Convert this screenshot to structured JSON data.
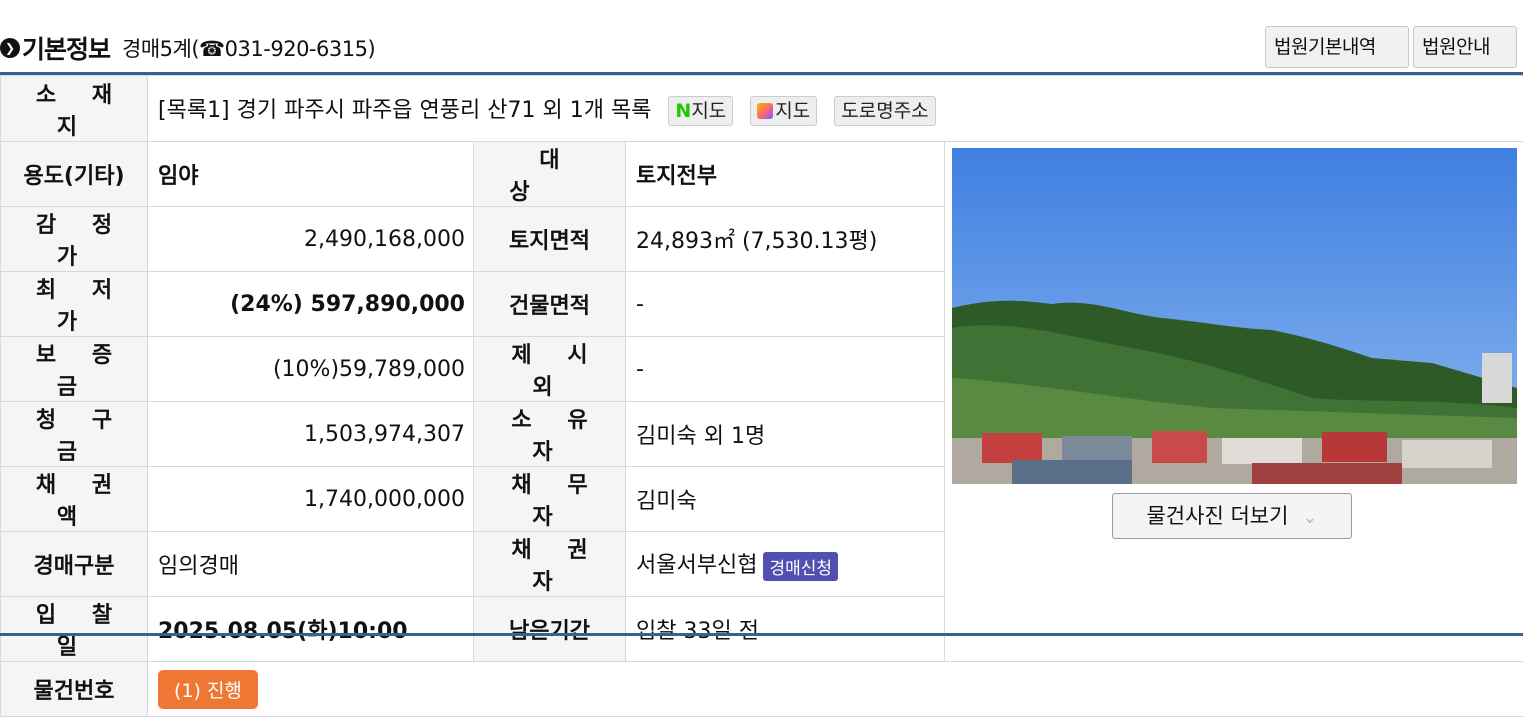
{
  "header": {
    "title": "기본정보",
    "department": "경매5계(☎031-920-6315)",
    "court_info_button": "법원기본내역",
    "court_guide_button": "법원안내"
  },
  "location": {
    "label": "소 재 지",
    "address": "[목록1] 경기 파주시 파주읍 연풍리 산71 외 1개 목록",
    "naver_map_logo": "N",
    "naver_map_label": "지도",
    "daum_map_label": "지도",
    "road_address_button": "도로명주소"
  },
  "rows": {
    "usage": {
      "label": "용도(기타)",
      "value": "임야"
    },
    "target": {
      "label": "대 상",
      "value": "토지전부"
    },
    "appraisal": {
      "label": "감 정 가",
      "value": "2,490,168,000"
    },
    "land_area": {
      "label": "토지면적",
      "value": "24,893㎡ (7,530.13평)"
    },
    "min_price": {
      "label": "최 저 가",
      "value": "(24%) 597,890,000"
    },
    "building_area": {
      "label": "건물면적",
      "value": "-"
    },
    "deposit": {
      "label": "보 증 금",
      "value": "(10%)59,789,000"
    },
    "excluded": {
      "label": "제 시 외",
      "value": "-"
    },
    "claim": {
      "label": "청 구 금",
      "value": "1,503,974,307"
    },
    "owner": {
      "label": "소 유 자",
      "value": "김미숙 외 1명"
    },
    "bond": {
      "label": "채 권 액",
      "value": "1,740,000,000"
    },
    "debtor": {
      "label": "채 무 자",
      "value": "김미숙"
    },
    "auction_type": {
      "label": "경매구분",
      "value": "임의경매"
    },
    "creditor": {
      "label": "채 권 자",
      "value": "서울서부신협",
      "badge": "경매신청"
    },
    "bid_date": {
      "label": "입 찰 일",
      "value": "2025.08.05(화)10:00"
    },
    "remaining": {
      "label": "남은기간",
      "value": "입찰 33일 전"
    },
    "item_no": {
      "label": "물건번호",
      "status": "(1) 진행"
    }
  },
  "photo": {
    "more_button": "물건사진 더보기"
  },
  "colors": {
    "accent_line": "#3a5f95",
    "blue_text": "#1010d0",
    "status_badge": "#ee7733",
    "apply_badge": "#5050b0"
  }
}
